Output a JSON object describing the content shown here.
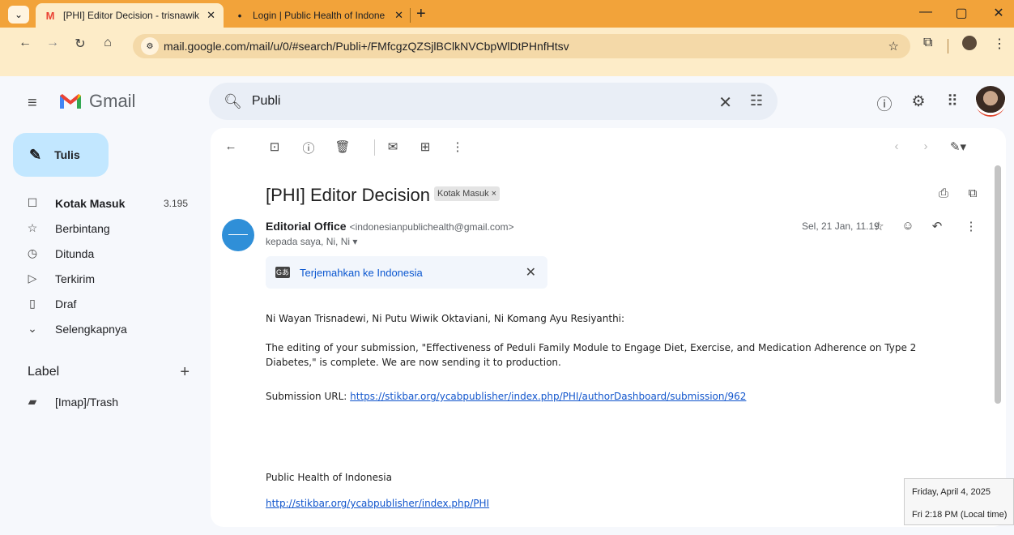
{
  "browser": {
    "tabs": [
      {
        "title": "[PHI] Editor Decision - trisnawik",
        "favicon": "M",
        "active": true
      },
      {
        "title": "Login | Public Health of Indone",
        "favicon": "•",
        "active": false
      }
    ],
    "url": "mail.google.com/mail/u/0/#search/Publi+/FMfcgzQZSjlBClkNVCbpWlDtPHnfHtsv"
  },
  "gmail": {
    "brand": "Gmail",
    "search_value": "Publi",
    "compose_label": "Tulis",
    "nav": [
      {
        "label": "Kotak Masuk",
        "count": "3.195",
        "icon": "inbox-icon",
        "glyph": "☐",
        "bold": true
      },
      {
        "label": "Berbintang",
        "count": "",
        "icon": "star-icon",
        "glyph": "☆",
        "bold": false
      },
      {
        "label": "Ditunda",
        "count": "",
        "icon": "clock-icon",
        "glyph": "◷",
        "bold": false
      },
      {
        "label": "Terkirim",
        "count": "",
        "icon": "send-icon",
        "glyph": "▷",
        "bold": false
      },
      {
        "label": "Draf",
        "count": "",
        "icon": "draft-icon",
        "glyph": "▯",
        "bold": false
      },
      {
        "label": "Selengkapnya",
        "count": "",
        "icon": "chevron-down-icon",
        "glyph": "⌄",
        "bold": false
      }
    ],
    "labels_heading": "Label",
    "labels": [
      {
        "label": "[Imap]/Trash",
        "icon": "label-icon"
      }
    ]
  },
  "email": {
    "subject": "[PHI] Editor Decision",
    "chip": "Kotak Masuk ×",
    "sender_name": "Editorial Office",
    "sender_email": "<indonesianpublichealth@gmail.com>",
    "recipients": "kepada saya, Ni, Ni ▾",
    "date": "Sel, 21 Jan, 11.19",
    "translate_label": "Terjemahkan ke Indonesia",
    "greeting": "Ni Wayan Trisnadewi, Ni Putu Wiwik Oktaviani, Ni Komang Ayu Resiyanthi:",
    "paragraph": "The editing of your submission, \"Effectiveness of Peduli Family Module to Engage Diet, Exercise, and Medication Adherence on Type 2 Diabetes,\" is complete. We are now sending it to production.",
    "submission_prefix": "Submission URL: ",
    "submission_url": "https://stikbar.org/ycabpublisher/index.php/PHI/authorDashboard/submission/962",
    "signature_name": "Public Health of Indonesia",
    "signature_url": "http://stikbar.org/ycabpublisher/index.php/PHI"
  },
  "datetime_tooltip": {
    "date": "Friday, April 4, 2025",
    "time": "Fri 2:18 PM (Local time)"
  },
  "colors": {
    "tabbar": "#f2a33a",
    "compose": "#c2e7ff",
    "link": "#1155cc"
  }
}
